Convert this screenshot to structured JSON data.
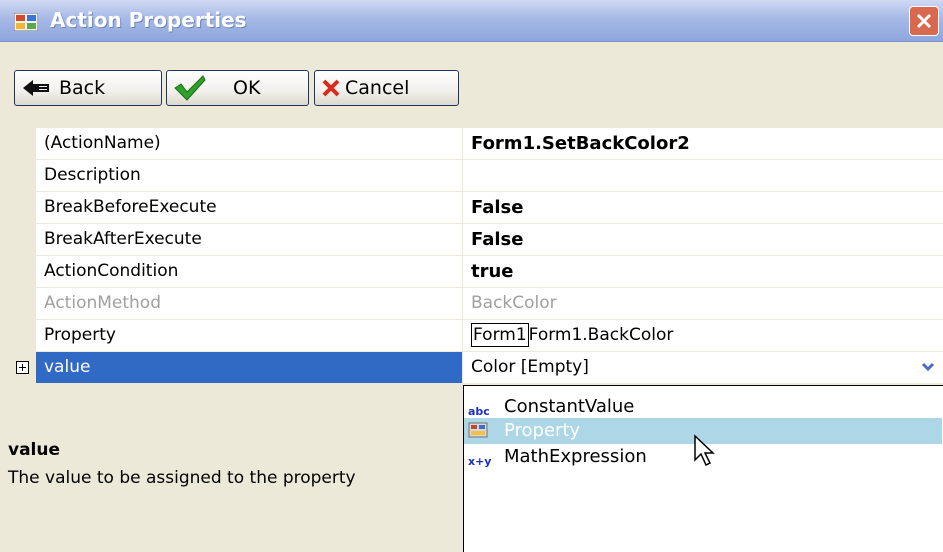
{
  "window": {
    "title": "Action Properties"
  },
  "toolbar": {
    "back_label": "Back",
    "ok_label": "OK",
    "cancel_label": "Cancel"
  },
  "grid": {
    "rows": [
      {
        "name": "(ActionName)",
        "value": "Form1.SetBackColor2"
      },
      {
        "name": "Description",
        "value": ""
      },
      {
        "name": "BreakBeforeExecute",
        "value": "False"
      },
      {
        "name": "BreakAfterExecute",
        "value": "False"
      },
      {
        "name": "ActionCondition",
        "value": "true"
      },
      {
        "name": "ActionMethod",
        "value": "BackColor"
      },
      {
        "name": "Property",
        "value_boxed": "Form1",
        "value": "Form1.BackColor"
      },
      {
        "name": "value",
        "value": "Color [Empty]"
      }
    ]
  },
  "description": {
    "title": "value",
    "text": "The value to be assigned to the property"
  },
  "dropdown": {
    "items": [
      {
        "label": "ConstantValue",
        "icon": "abc"
      },
      {
        "label": "Property",
        "icon": "property-icon"
      },
      {
        "label": "MathExpression",
        "icon": "x+y"
      }
    ],
    "highlighted": "Property"
  },
  "colors": {
    "selection": "#316ac5",
    "hover": "#add7e6",
    "background": "#ece9d8"
  }
}
